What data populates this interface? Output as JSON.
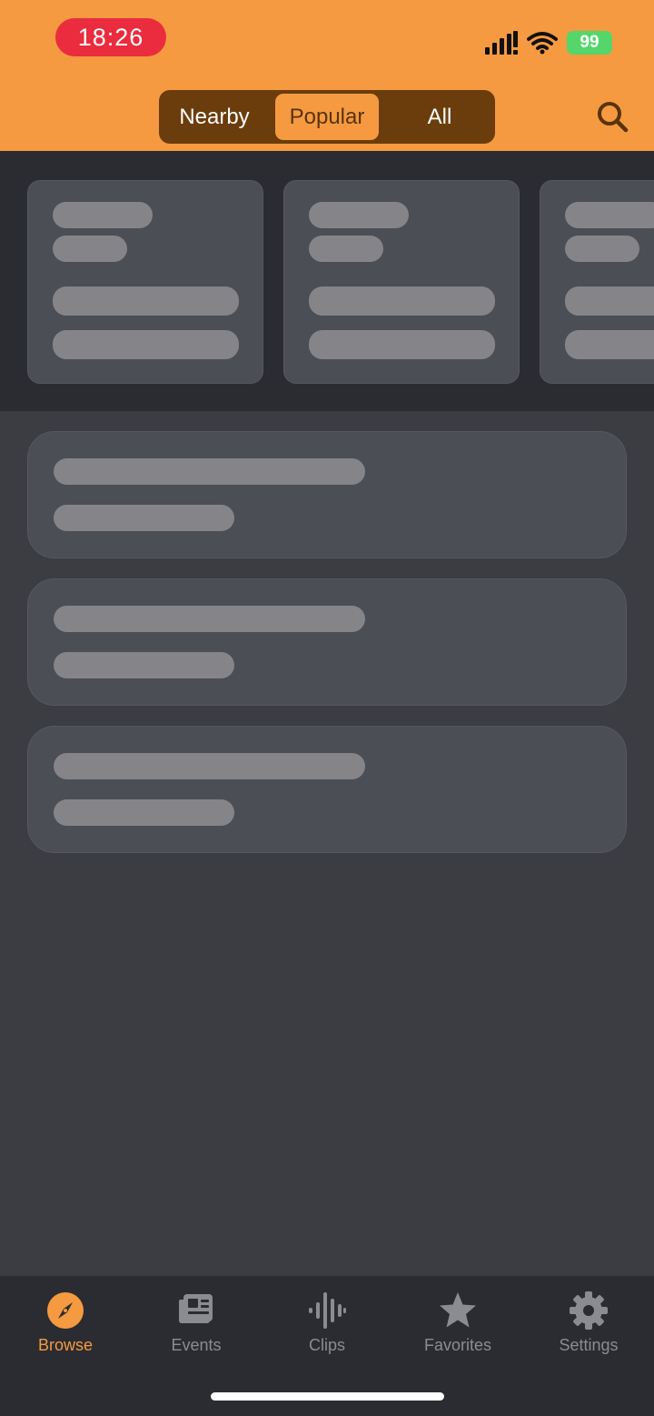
{
  "status_bar": {
    "time": "18:26",
    "battery": "99"
  },
  "header": {
    "segments": [
      "Nearby",
      "Popular",
      "All"
    ],
    "selected_segment": "Popular",
    "search_icon": "search-icon"
  },
  "tab_bar": {
    "items": [
      {
        "label": "Browse",
        "icon": "compass-icon",
        "active": true
      },
      {
        "label": "Events",
        "icon": "newspaper-icon",
        "active": false
      },
      {
        "label": "Clips",
        "icon": "waveform-icon",
        "active": false
      },
      {
        "label": "Favorites",
        "icon": "star-icon",
        "active": false
      },
      {
        "label": "Settings",
        "icon": "gear-icon",
        "active": false
      }
    ]
  },
  "colors": {
    "accent": "#f59a40",
    "segment_bg": "#6b3d0c",
    "background": "#3c3d42",
    "skeleton_card": "#4b4e55",
    "skeleton_bar": "#858589",
    "time_pill": "#ea2c3e",
    "battery": "#55d66a"
  }
}
